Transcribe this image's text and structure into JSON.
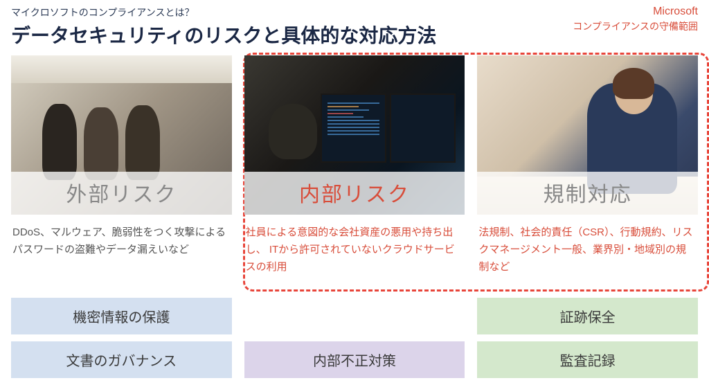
{
  "header": {
    "subtitle": "マイクロソフトのコンプライアンスとは？",
    "title": "データセキュリティのリスクと具体的な対応方法",
    "logo": "Microsoft",
    "logo_sub": "コンプライアンスの守備範囲"
  },
  "cards": [
    {
      "label": "外部リスク",
      "label_color": "gray",
      "desc": "DDoS、マルウェア、脆弱性をつく攻撃によるパスワードの盗難やデータ漏えいなど",
      "desc_color": "gray"
    },
    {
      "label": "内部リスク",
      "label_color": "red",
      "desc": "社員による意図的な会社資産の悪用や持ち出し、 ITから許可されていないクラウドサービスの利用",
      "desc_color": "red"
    },
    {
      "label": "規制対応",
      "label_color": "gray",
      "desc": "法規制、社会的責任（CSR）、行動規約、リスクマネージメント一般、業界別・地域別の規制など",
      "desc_color": "red"
    }
  ],
  "bottom": {
    "col1": [
      "機密情報の保護",
      "文書のガバナンス"
    ],
    "col2": [
      "内部不正対策"
    ],
    "col3": [
      "証跡保全",
      "監査記録"
    ]
  }
}
